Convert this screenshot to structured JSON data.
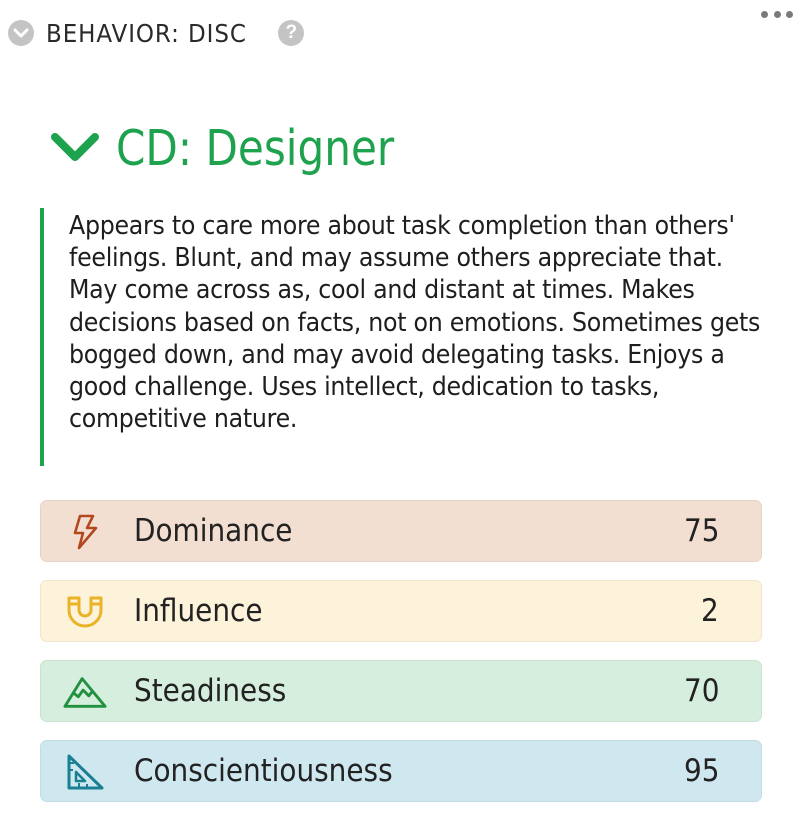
{
  "header": {
    "title": "BEHAVIOR: DISC",
    "help_label": "?"
  },
  "profile": {
    "type_title": "CD: Designer",
    "description": "Appears to care more about task completion than others' feelings. Blunt, and may assume others appreciate that. May come across as, cool and distant at times. Makes decisions based on facts, not on emotions. Sometimes gets bogged down, and may avoid delegating tasks. Enjoys a good challenge. Uses intellect, dedication to tasks, competitive nature.",
    "accent_color": "#1ea24e"
  },
  "traits": [
    {
      "label": "Dominance",
      "value": "75",
      "icon": "lightning-icon",
      "bg": "#f3dfd2",
      "color": "#b3481e"
    },
    {
      "label": "Influence",
      "value": "2",
      "icon": "magnet-icon",
      "bg": "#fdf2da",
      "color": "#e9b325"
    },
    {
      "label": "Steadiness",
      "value": "70",
      "icon": "mountain-icon",
      "bg": "#d5eedd",
      "color": "#22903f"
    },
    {
      "label": "Conscientiousness",
      "value": "95",
      "icon": "set-square-icon",
      "bg": "#cfe8ef",
      "color": "#1b7f93"
    }
  ]
}
